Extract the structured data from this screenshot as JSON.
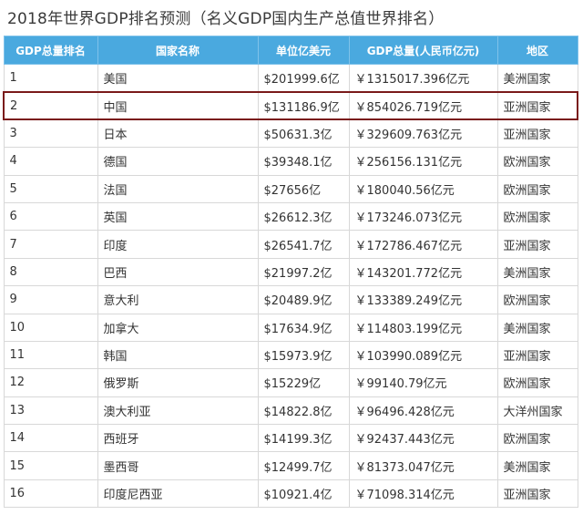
{
  "title": "2018年世界GDP排名预测（名义GDP国内生产总值世界排名）",
  "table": {
    "headers": [
      "GDP总量排名",
      "国家名称",
      "单位亿美元",
      "GDP总量(人民币亿元)",
      "地区"
    ],
    "highlight_row": 2,
    "highlight_color": "#7a1a1a",
    "header_color": "#4aa9df",
    "rows": [
      {
        "rank": "1",
        "country": "美国",
        "usd": "$201999.6亿",
        "cny": "￥1315017.396亿元",
        "region": "美洲国家"
      },
      {
        "rank": "2",
        "country": "中国",
        "usd": "$131186.9亿",
        "cny": "￥854026.719亿元",
        "region": "亚洲国家"
      },
      {
        "rank": "3",
        "country": "日本",
        "usd": "$50631.3亿",
        "cny": "￥329609.763亿元",
        "region": "亚洲国家"
      },
      {
        "rank": "4",
        "country": "德国",
        "usd": "$39348.1亿",
        "cny": "￥256156.131亿元",
        "region": "欧洲国家"
      },
      {
        "rank": "5",
        "country": "法国",
        "usd": "$27656亿",
        "cny": "￥180040.56亿元",
        "region": "欧洲国家"
      },
      {
        "rank": "6",
        "country": "英国",
        "usd": "$26612.3亿",
        "cny": "￥173246.073亿元",
        "region": "欧洲国家"
      },
      {
        "rank": "7",
        "country": "印度",
        "usd": "$26541.7亿",
        "cny": "￥172786.467亿元",
        "region": "亚洲国家"
      },
      {
        "rank": "8",
        "country": "巴西",
        "usd": "$21997.2亿",
        "cny": "￥143201.772亿元",
        "region": "美洲国家"
      },
      {
        "rank": "9",
        "country": "意大利",
        "usd": "$20489.9亿",
        "cny": "￥133389.249亿元",
        "region": "欧洲国家"
      },
      {
        "rank": "10",
        "country": "加拿大",
        "usd": "$17634.9亿",
        "cny": "￥114803.199亿元",
        "region": "美洲国家"
      },
      {
        "rank": "11",
        "country": "韩国",
        "usd": "$15973.9亿",
        "cny": "￥103990.089亿元",
        "region": "亚洲国家"
      },
      {
        "rank": "12",
        "country": "俄罗斯",
        "usd": "$15229亿",
        "cny": "￥99140.79亿元",
        "region": "欧洲国家"
      },
      {
        "rank": "13",
        "country": "澳大利亚",
        "usd": "$14822.8亿",
        "cny": "￥96496.428亿元",
        "region": "大洋州国家"
      },
      {
        "rank": "14",
        "country": "西班牙",
        "usd": "$14199.3亿",
        "cny": "￥92437.443亿元",
        "region": "欧洲国家"
      },
      {
        "rank": "15",
        "country": "墨西哥",
        "usd": "$12499.7亿",
        "cny": "￥81373.047亿元",
        "region": "美洲国家"
      },
      {
        "rank": "16",
        "country": "印度尼西亚",
        "usd": "$10921.4亿",
        "cny": "￥71098.314亿元",
        "region": "亚洲国家"
      }
    ]
  }
}
